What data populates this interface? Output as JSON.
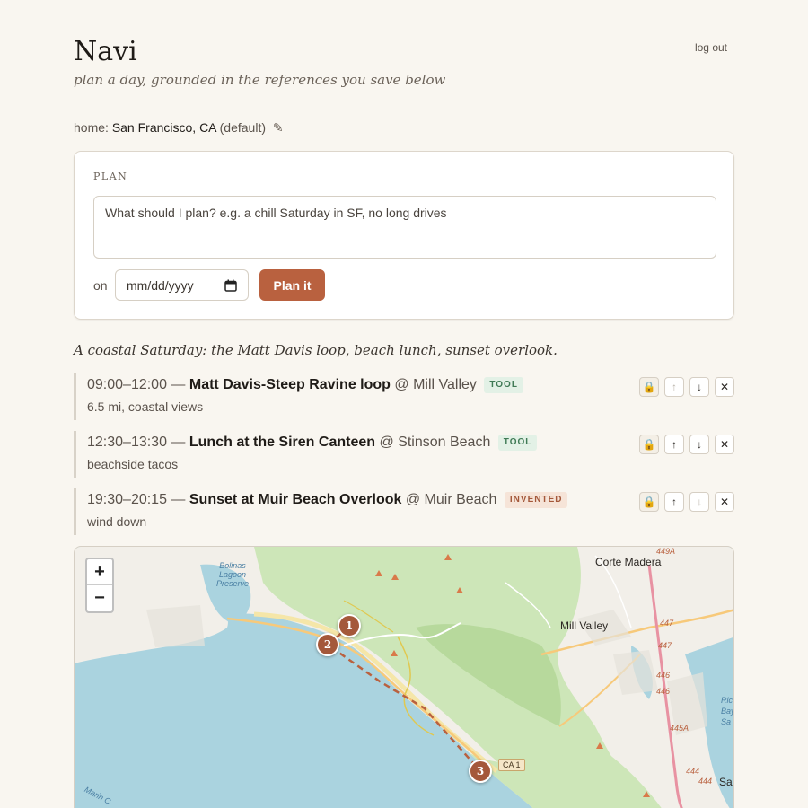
{
  "app": {
    "title": "Navi",
    "tagline": "plan a day, grounded in the references you save below",
    "logout_label": "log out"
  },
  "home": {
    "label": "home:",
    "value": "San Francisco, CA",
    "suffix": "(default)",
    "edit_icon": "pencil-icon"
  },
  "plan_form": {
    "section_label": "PLAN",
    "prompt_placeholder": "What should I plan? e.g. a chill Saturday in SF, no long drives",
    "date_label": "on",
    "date_placeholder": "mm/dd/yyyy",
    "submit_label": "Plan it"
  },
  "itinerary": {
    "summary": "A coastal Saturday: the Matt Davis loop, beach lunch, sunset overlook.",
    "items": [
      {
        "time": "09:00–12:00 —",
        "name": "Matt Davis-Steep Ravine loop",
        "location": "@ Mill Valley",
        "badge": "TOOL",
        "note": "6.5 mi, coastal views",
        "up_disabled": true,
        "down_disabled": false
      },
      {
        "time": "12:30–13:30 —",
        "name": "Lunch at the Siren Canteen",
        "location": "@ Stinson Beach",
        "badge": "TOOL",
        "note": "beachside tacos",
        "up_disabled": false,
        "down_disabled": false
      },
      {
        "time": "19:30–20:15 —",
        "name": "Sunset at Muir Beach Overlook",
        "location": "@ Muir Beach",
        "badge": "INVENTED",
        "note": "wind down",
        "up_disabled": false,
        "down_disabled": true
      }
    ]
  },
  "map": {
    "zoom_in": "+",
    "zoom_out": "−",
    "markers": [
      "1",
      "2",
      "3"
    ],
    "place_labels": {
      "corte_madera": "Corte Madera",
      "mill_valley": "Mill Valley",
      "bolinas_lagoon": "Bolinas Lagoon Preserve",
      "marin": "Marin C"
    },
    "road_shields": {
      "ca1": "CA 1",
      "r447a": "447",
      "r447b": "447",
      "r446a": "446",
      "r446b": "446",
      "r445a": "445A",
      "r444a": "444",
      "r444b": "444",
      "r449a": "449A"
    },
    "edge_text": {
      "ric": "Ric",
      "bay": "Bay",
      "sa": "Sa",
      "sau": "Sau"
    },
    "colors": {
      "water": "#aad3df",
      "land": "#f2efe9",
      "park": "#cde6b8",
      "route": "#b9613f"
    }
  }
}
